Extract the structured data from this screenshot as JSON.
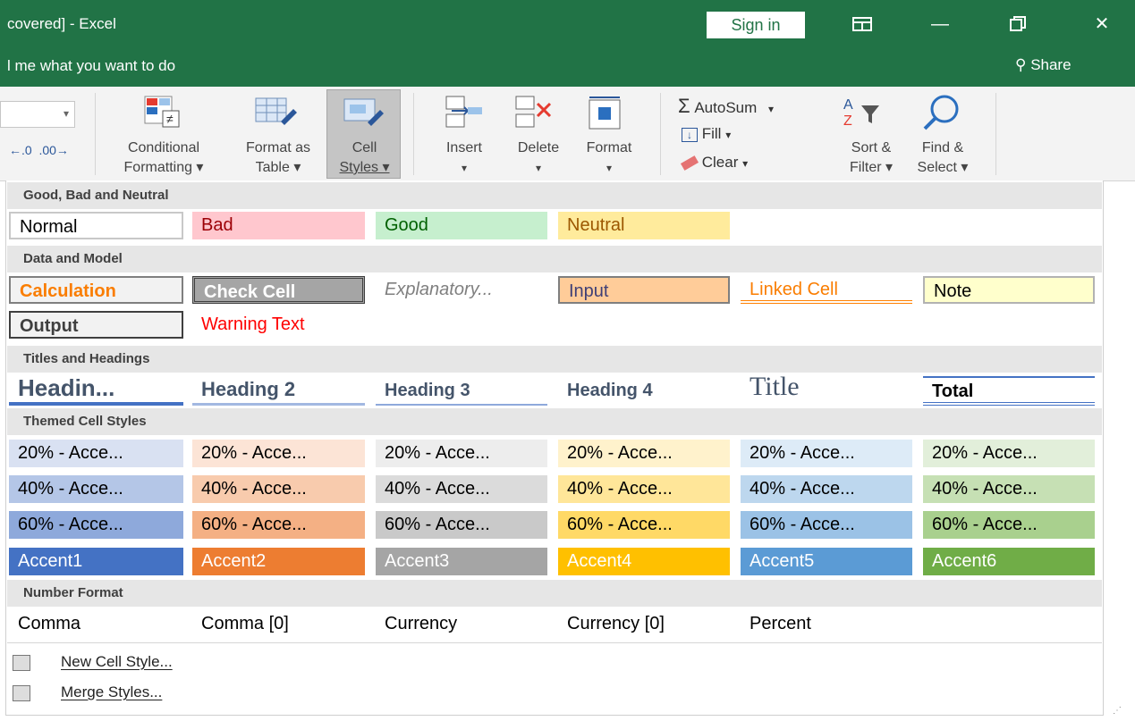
{
  "window": {
    "title": "covered] - Excel",
    "tell_me": "l me what you want to do",
    "sign_in": "Sign in",
    "share": "Share"
  },
  "ribbon": {
    "conditional_formatting": [
      "Conditional",
      "Formatting ▾"
    ],
    "format_as_table": [
      "Format as",
      "Table ▾"
    ],
    "cell_styles": [
      "Cell",
      "Styles ▾"
    ],
    "insert": "Insert",
    "delete": "Delete",
    "format": "Format",
    "autosum": "AutoSum",
    "fill": "Fill",
    "clear": "Clear",
    "sort_filter": [
      "Sort &",
      "Filter ▾"
    ],
    "find_select": [
      "Find &",
      "Select ▾"
    ]
  },
  "gallery": {
    "sections": {
      "good_bad": "Good, Bad and Neutral",
      "data_model": "Data and Model",
      "titles": "Titles and Headings",
      "themed": "Themed Cell Styles",
      "number": "Number Format"
    },
    "good_bad": [
      "Normal",
      "Bad",
      "Good",
      "Neutral"
    ],
    "data_model_row1": [
      "Calculation",
      "Check Cell",
      "Explanatory...",
      "Input",
      "Linked Cell",
      "Note"
    ],
    "data_model_row2": [
      "Output",
      "Warning Text"
    ],
    "titles": [
      "Headin...",
      "Heading 2",
      "Heading 3",
      "Heading 4",
      "Title",
      "Total"
    ],
    "themed_20": [
      "20% - Acce...",
      "20% - Acce...",
      "20% - Acce...",
      "20% - Acce...",
      "20% - Acce...",
      "20% - Acce..."
    ],
    "themed_40": [
      "40% - Acce...",
      "40% - Acce...",
      "40% - Acce...",
      "40% - Acce...",
      "40% - Acce...",
      "40% - Acce..."
    ],
    "themed_60": [
      "60% - Acce...",
      "60% - Acce...",
      "60% - Acce...",
      "60% - Acce...",
      "60% - Acce...",
      "60% - Acce..."
    ],
    "accents": [
      "Accent1",
      "Accent2",
      "Accent3",
      "Accent4",
      "Accent5",
      "Accent6"
    ],
    "number": [
      "Comma",
      "Comma [0]",
      "Currency",
      "Currency [0]",
      "Percent"
    ]
  },
  "menu": {
    "new_style": "New Cell Style...",
    "merge": "Merge Styles..."
  },
  "colors": {
    "excel_green": "#217346",
    "accent1": "#4472c4",
    "accent2": "#ed7d31",
    "accent3": "#a5a5a5",
    "accent4": "#ffc000",
    "accent5": "#5b9bd5",
    "accent6": "#70ad47"
  }
}
